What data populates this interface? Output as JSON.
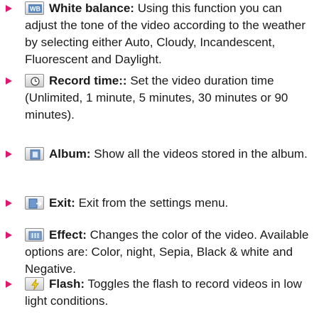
{
  "items": [
    {
      "icon": "white-balance-icon",
      "term": "White balance:",
      "desc": "Using this function you can adjust the tone of the video according to the weather by selecting either Auto, Cloudy, Incandescent, Fluorescent and Daylight."
    },
    {
      "icon": "clock-icon",
      "term": "Record time::",
      "desc": "Set the video duration time (Unlimited, 1 minute, 5 minutes, 30 minutes or 90 minutes)."
    },
    {
      "icon": "album-icon",
      "term": "Album:",
      "desc": "Show all the videos stored in the album."
    },
    {
      "icon": "exit-icon",
      "term": "Exit:",
      "desc": "Exit from the settings menu."
    },
    {
      "icon": "effect-icon",
      "term": "Effect:",
      "desc": "Changes the color of the video. Available options are: Color, night, Sepia, Black & white and Negative."
    },
    {
      "icon": "flash-icon",
      "term": "Flash:",
      "desc": "Toggles the flash to record videos in low light conditions."
    }
  ],
  "colors": {
    "bullet": "#e0166f",
    "icon_blue": "#5b86bd",
    "flash_yellow": "#f1d21a"
  }
}
